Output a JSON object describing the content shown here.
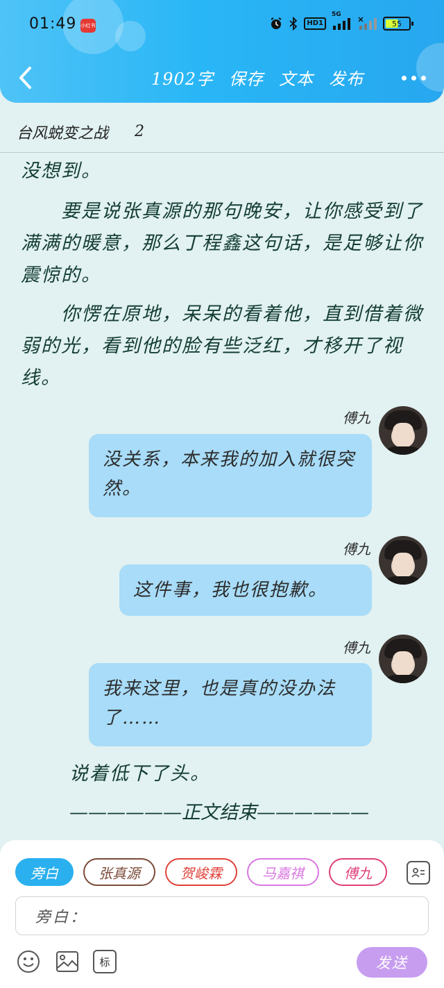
{
  "status_bar": {
    "time": "01:49",
    "notification_badge": "小红书",
    "hd_label": "HD1",
    "network_label": "5G",
    "battery_level": "55",
    "battery_fraction": 0.55
  },
  "nav": {
    "word_count": "1902字",
    "save": "保存",
    "text": "文本",
    "publish": "发布"
  },
  "story": {
    "title": "台风蜕变之战",
    "chapter": "2"
  },
  "narration": [
    "没想到。",
    "　　要是说张真源的那句晚安，让你感受到了满满的暖意，那么丁程鑫这句话，是足够让你震惊的。",
    "　　你愣在原地，呆呆的看着他，直到借着微弱的光，看到他的脸有些泛红，才移开了视线。"
  ],
  "messages": [
    {
      "speaker": "傅九",
      "text": "没关系，本来我的加入就很突然。"
    },
    {
      "speaker": "傅九",
      "text": "这件事，我也很抱歉。"
    },
    {
      "speaker": "傅九",
      "text": "我来这里，也是真的没办法了……"
    }
  ],
  "closing": {
    "line": "说着低下了头。",
    "end_marker": "——————正文结束——————"
  },
  "chips": [
    {
      "label": "旁白",
      "color": "#2ab0ee",
      "active": true
    },
    {
      "label": "张真源",
      "color": "#7a4a38",
      "active": false
    },
    {
      "label": "贺峻霖",
      "color": "#e0413a",
      "active": false
    },
    {
      "label": "马嘉祺",
      "color": "#d878e0",
      "active": false
    },
    {
      "label": "傅九",
      "color": "#e03f7a",
      "active": false
    }
  ],
  "composer": {
    "input_label": "旁白：",
    "mark_label": "标",
    "send": "发送"
  },
  "icons": [
    "back-arrow-icon",
    "more-dots-icon",
    "alarm-icon",
    "bluetooth-icon",
    "signal-icon",
    "battery-icon",
    "contact-card-icon",
    "emoji-icon",
    "image-icon"
  ]
}
